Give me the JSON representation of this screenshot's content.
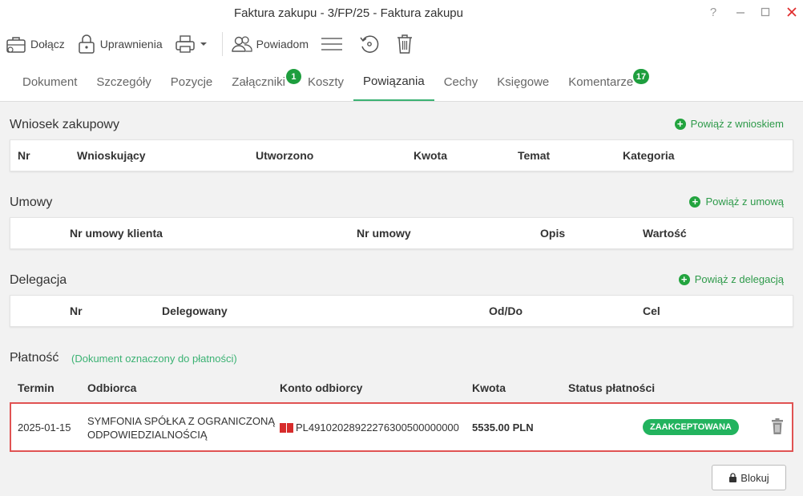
{
  "window": {
    "title": "Faktura zakupu - 3/FP/25 - Faktura zakupu",
    "help": "?"
  },
  "toolbar": {
    "attach": "Dołącz",
    "permissions": "Uprawnienia",
    "notify": "Powiadom"
  },
  "tabs": [
    {
      "label": "Dokument"
    },
    {
      "label": "Szczegóły"
    },
    {
      "label": "Pozycje"
    },
    {
      "label": "Załączniki",
      "badge": "1"
    },
    {
      "label": "Koszty"
    },
    {
      "label": "Powiązania"
    },
    {
      "label": "Cechy"
    },
    {
      "label": "Księgowe"
    },
    {
      "label": "Komentarze",
      "badge": "17"
    }
  ],
  "purchase_request": {
    "title": "Wniosek zakupowy",
    "link": "Powiąż z wnioskiem",
    "columns": [
      "Nr",
      "Wnioskujący",
      "Utworzono",
      "Kwota",
      "Temat",
      "Kategoria"
    ]
  },
  "contracts": {
    "title": "Umowy",
    "link": "Powiąż z umową",
    "columns": [
      "Nr umowy klienta",
      "Nr umowy",
      "Opis",
      "Wartość"
    ]
  },
  "delegation": {
    "title": "Delegacja",
    "link": "Powiąż z delegacją",
    "columns": [
      "Nr",
      "Delegowany",
      "Od/Do",
      "Cel"
    ]
  },
  "payment": {
    "title": "Płatność",
    "note": "(Dokument oznaczony do płatności)",
    "columns": [
      "Termin",
      "Odbiorca",
      "Konto odbiorcy",
      "Kwota",
      "Status płatności"
    ],
    "row": {
      "date": "2025-01-15",
      "recipient_line1": "SYMFONIA SPÓŁKA Z OGRANICZONĄ",
      "recipient_line2": "ODPOWIEDZIALNOŚCIĄ",
      "account": "PL49102028922276300500000000",
      "amount": "5535.00 PLN",
      "status": "ZAAKCEPTOWANA"
    }
  },
  "block_button": "Blokuj",
  "colors": {
    "accent_green": "#3bb273",
    "badge_green": "#1e9e3e",
    "status_green": "#22b35e",
    "highlight_red": "#e05353"
  }
}
